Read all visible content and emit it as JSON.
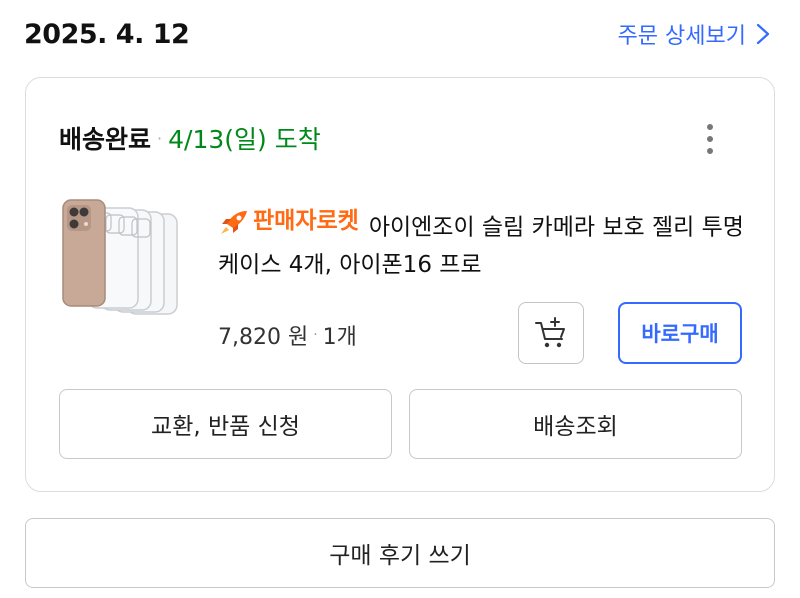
{
  "header": {
    "order_date": "2025. 4. 12",
    "detail_link_label": "주문 상세보기"
  },
  "order": {
    "status": "배송완료",
    "separator": "·",
    "arrival": "4/13(일) 도착",
    "product": {
      "badge": "판매자로켓",
      "name": "아이엔조이 슬림 카메라 보호 젤리 투명 케이스 4개, 아이폰16 프로",
      "price": "7,820 원",
      "quantity": "1개",
      "image_icon": "product-image"
    },
    "buy_now_label": "바로구매",
    "exchange_return_label": "교환, 반품 신청",
    "tracking_label": "배송조회"
  },
  "review_label": "구매 후기 쓰기",
  "colors": {
    "accent_blue": "#346aff",
    "status_green": "#00891a",
    "badge_orange": "#ff6a13",
    "border": "#c8c8c8"
  },
  "icons": [
    "chevron-right-icon",
    "more-vertical-icon",
    "rocket-icon",
    "add-to-cart-icon"
  ]
}
